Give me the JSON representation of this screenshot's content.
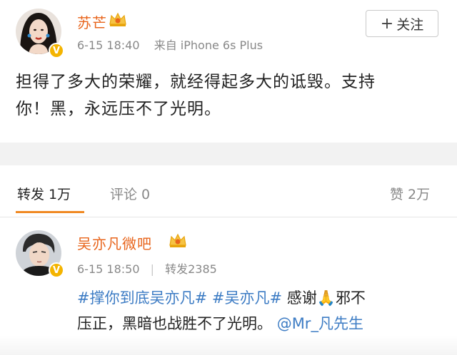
{
  "post": {
    "username": "苏芒",
    "timestamp": "6-15 18:40",
    "source": "来自 iPhone 6s Plus",
    "follow_label": "关注",
    "follow_icon": "+",
    "text_line1": "担得了多大的荣耀，就经得起多大的诋毁。支持",
    "text_line2": "你！黑，永远压不了光明。"
  },
  "tabs": {
    "repost": "转发 1万",
    "comment": "评论 0",
    "like": "赞 2万"
  },
  "repost_item": {
    "username": "吴亦凡微吧",
    "timestamp": "6-15 18:50",
    "repost_count": "转发2385",
    "hashtag1": "#撑你到底吴亦凡#",
    "hashtag2": "#吴亦凡#",
    "text_a": "感谢",
    "emoji": "🙏",
    "text_b": "邪不",
    "text_c": "压正，黑暗也战胜不了光明。",
    "mention": "@Mr_凡先生"
  },
  "colors": {
    "username": "#e8641b",
    "link": "#3d7cc4",
    "tab_underline": "#f08a24",
    "verified": "#f4b400",
    "crown": "#e8a40c"
  },
  "icons": [
    "verified-badge-icon",
    "vip-crown-icon",
    "plus-icon",
    "pray-emoji-icon"
  ]
}
